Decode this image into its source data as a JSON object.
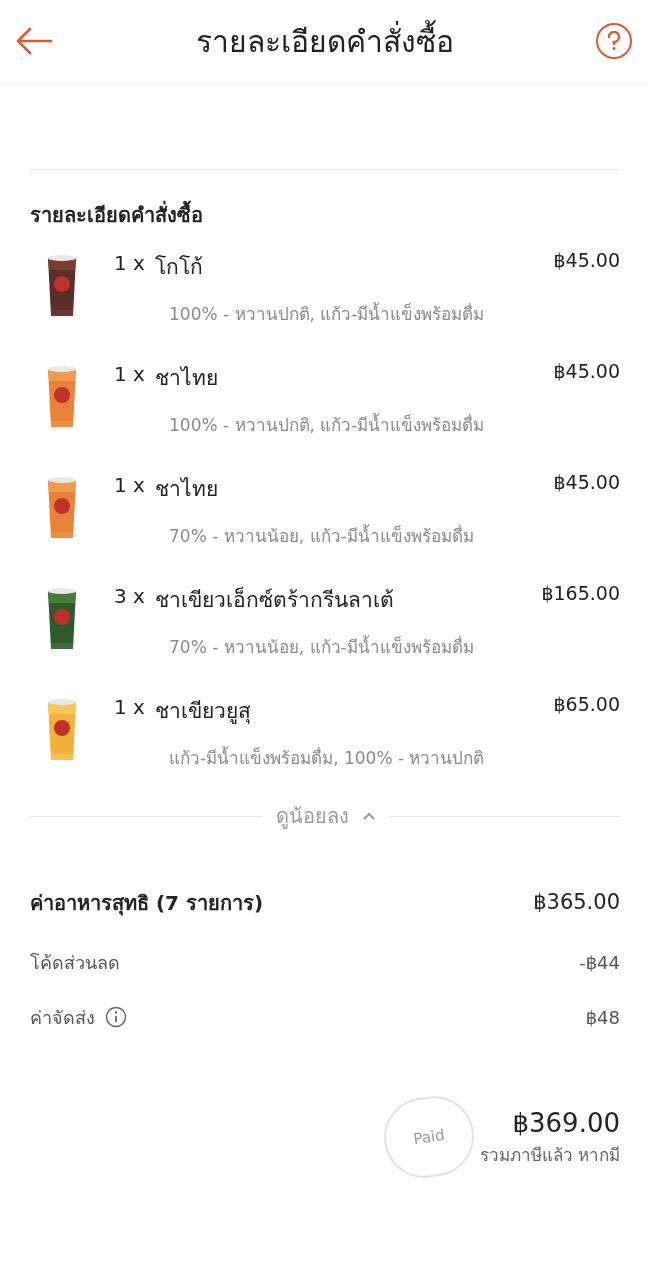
{
  "header": {
    "title": "รายละเอียดคำสั่งซื้อ"
  },
  "section_title": "รายละเอียดคำสั่งซื้อ",
  "items": [
    {
      "qty": "1 x",
      "name": "โกโก้",
      "price": "฿45.00",
      "options": "100% - หวานปกติ, แก้ว-มีน้ำแข็งพร้อมดื่ม"
    },
    {
      "qty": "1 x",
      "name": "ชาไทย",
      "price": "฿45.00",
      "options": "100% - หวานปกติ, แก้ว-มีน้ำแข็งพร้อมดื่ม"
    },
    {
      "qty": "1 x",
      "name": "ชาไทย",
      "price": "฿45.00",
      "options": "70% - หวานน้อย, แก้ว-มีน้ำแข็งพร้อมดื่ม"
    },
    {
      "qty": "3 x",
      "name": "ชาเขียวเอ็กซ์ตร้ากรีนลาเต้",
      "price": "฿165.00",
      "options": "70% - หวานน้อย, แก้ว-มีน้ำแข็งพร้อมดื่ม"
    },
    {
      "qty": "1 x",
      "name": "ชาเขียวยูสุ",
      "price": "฿65.00",
      "options": "แก้ว-มีน้ำแข็งพร้อมดื่ม, 100% - หวานปกติ"
    }
  ],
  "toggle": {
    "label": "ดูน้อยลง",
    "expanded": true
  },
  "subtotal": {
    "label": "ค่าอาหารสุทธิ (7 รายการ)",
    "value": "฿365.00"
  },
  "rows": [
    {
      "label": "โค้ดส่วนลด",
      "value": "-฿44",
      "info": false
    },
    {
      "label": "ค่าจัดส่ง",
      "value": "฿48",
      "info": true
    }
  ],
  "total": {
    "value": "฿369.00",
    "note": "รวมภาษีแล้ว หากมี",
    "stamp": "Paid"
  }
}
